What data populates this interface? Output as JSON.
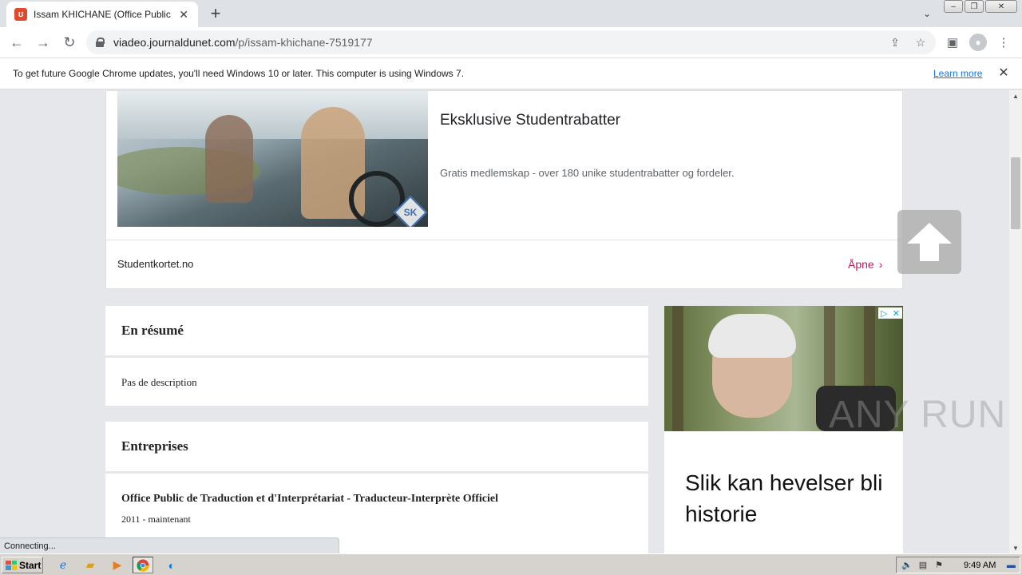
{
  "browser": {
    "tab_title": "Issam KHICHANE (Office Public de Tr",
    "tab_favicon_letter": "ʊ",
    "url_host": "viadeo.journaldunet.com",
    "url_path": "/p/issam-khichane-7519177"
  },
  "infobar": {
    "message": "To get future Google Chrome updates, you'll need Windows 10 or later. This computer is using Windows 7.",
    "link": "Learn more"
  },
  "ad_top": {
    "title": "Eksklusive Studentrabatter",
    "description": "Gratis medlemskap - over 180 unike studentrabatter og fordeler.",
    "source": "Studentkortet.no",
    "cta": "Åpne",
    "logo_text": "SK"
  },
  "resume": {
    "heading": "En résumé",
    "body": "Pas de description"
  },
  "companies": {
    "heading": "Entreprises",
    "items": [
      {
        "name": "Office Public de Traduction et d'Interprétariat - Traducteur-Interprète Officiel",
        "period": "2011 - maintenant"
      }
    ]
  },
  "side_ad": {
    "headline": "Slik kan hevelser bli historie"
  },
  "watermark": "ANY RUN",
  "status_text": "Connecting...",
  "taskbar": {
    "start_label": "Start",
    "clock": "9:49 AM"
  },
  "colors": {
    "cta": "#c2185b",
    "link": "#1a73e8"
  }
}
